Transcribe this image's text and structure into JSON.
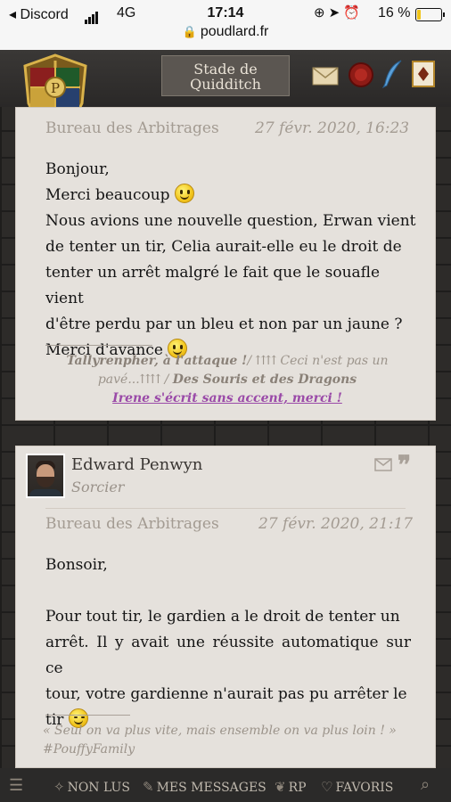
{
  "status_bar": {
    "carrier": "Discord",
    "network": "4G",
    "time": "17:14",
    "battery": "16 %",
    "url": "poudlard.fr"
  },
  "header": {
    "location_button": "Stade de\nQuidditch",
    "icons": [
      "crest-icon",
      "mail-icon",
      "seal-icon",
      "quill-icon",
      "card-icon"
    ]
  },
  "post1": {
    "forum": "Bureau des Arbitrages",
    "date": "27 févr. 2020, 16:23",
    "lines": [
      "Bonjour,",
      "Merci beaucoup",
      "Nous avions une nouvelle question, Erwan vient",
      "de tenter un tir, Celia aurait-elle eu le droit de",
      "tenter un arrêt malgré le fait que le souafle vient",
      "d'être perdu par un bleu et non par un jaune ?",
      "Merci d'avance"
    ],
    "signature": {
      "part1": "Tallyrenpher, à l'attaque !",
      "part2": "/ ⇈⇈ Ceci n'est pas un",
      "part3": "pavé...⇈⇈ /",
      "part4": "Des Souris et des Dragons",
      "link": "Irene s'écrit sans accent, merci !"
    }
  },
  "post2": {
    "author": "Edward Penwyn",
    "role": "Sorcier",
    "forum": "Bureau des Arbitrages",
    "date": "27 févr. 2020, 21:17",
    "lines": [
      "Bonsoir,",
      "",
      "Pour tout tir, le gardien a le droit de tenter un",
      "arrêt. Il y avait une réussite automatique sur ce",
      "tour, votre gardienne n'aurait pas pu arrêter le",
      "tir"
    ],
    "signature": {
      "quote": "« Seul on va plus vite, mais ensemble on va plus loin ! »",
      "tag": "#PouffyFamily"
    }
  },
  "bottom_nav": {
    "unread": "NON LUS",
    "messages": "MES MESSAGES",
    "rp": "RP",
    "favorites": "FAVORIS"
  },
  "colors": {
    "card_bg": "#e5e1dc",
    "link": "#9a4aa8",
    "page_bg": "#2d2b29"
  }
}
